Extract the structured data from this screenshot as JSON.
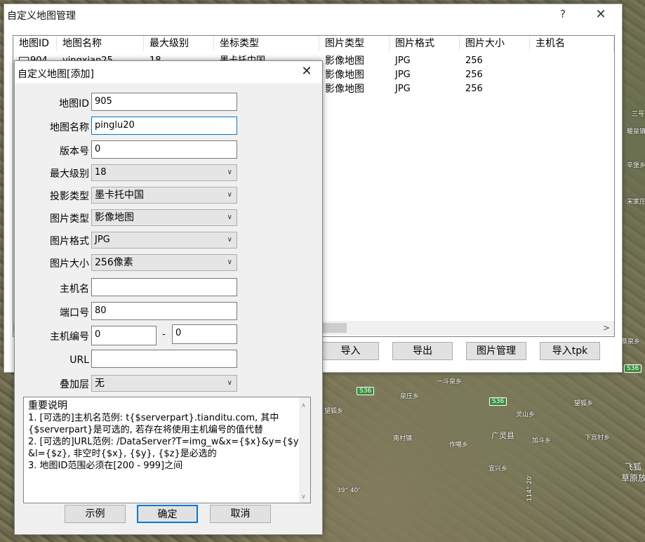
{
  "map": {
    "labels": [
      "三号",
      "辛堡乡",
      "泉庄乡",
      "一斗泉乡",
      "灵山乡",
      "南村镇",
      "作噶乡",
      "广灵县",
      "加斗乡",
      "宜兴乡",
      "下宫村乡",
      "望狐乡",
      "望狐乡",
      "飞狐",
      "草原放",
      "39° 40'",
      "114° 20'",
      "蔡泉乡",
      "宋家庄",
      "暖泉镇"
    ],
    "roads": [
      "S36",
      "S36",
      "S36"
    ]
  },
  "main_window": {
    "title": "自定义地图管理",
    "help": "?",
    "close": "✕",
    "columns": [
      "地图ID",
      "地图名称",
      "最大级别",
      "坐标类型",
      "图片类型",
      "图片格式",
      "图片大小",
      "主机名"
    ],
    "rows": [
      {
        "id": "904",
        "name": "yingxian25",
        "level": "18",
        "coord": "墨卡托中国",
        "type": "影像地图",
        "format": "JPG",
        "size": "256",
        "host": ""
      },
      {
        "id": "",
        "name": "",
        "level": "",
        "coord": "",
        "type": "影像地图",
        "format": "JPG",
        "size": "256",
        "host": ""
      },
      {
        "id": "",
        "name": "",
        "level": "",
        "coord": "",
        "type": "影像地图",
        "format": "JPG",
        "size": "256",
        "host": ""
      }
    ],
    "scroll_right": ">",
    "buttons": {
      "import": "导入",
      "export": "导出",
      "image_mgmt": "图片管理",
      "import_tpk": "导入tpk"
    }
  },
  "dialog": {
    "title": "自定义地图[添加]",
    "close": "✕",
    "labels": {
      "map_id": "地图ID",
      "map_name": "地图名称",
      "version": "版本号",
      "max_level": "最大级别",
      "projection": "投影类型",
      "image_type": "图片类型",
      "image_format": "图片格式",
      "image_size": "图片大小",
      "host": "主机名",
      "port": "端口号",
      "host_no": "主机编号",
      "url": "URL",
      "overlay": "叠加层"
    },
    "values": {
      "map_id": "905",
      "map_name": "pinglu20",
      "version": "0",
      "max_level": "18",
      "projection": "墨卡托中国",
      "image_type": "影像地图",
      "image_format": "JPG",
      "image_size": "256像素",
      "host": "",
      "port": "80",
      "host_no_from": "0",
      "host_no_to": "0",
      "url": "",
      "overlay": "无"
    },
    "dash": "-",
    "notes": [
      "重要说明",
      "1. [可选的]主机名范例: t{$serverpart}.tianditu.com, 其中",
      "{$serverpart}是可选的, 若存在将使用主机编号的值代替",
      "2. [可选的]URL范例: /DataServer?T=img_w&x={$x}&y={$y}",
      "&l={$z}, 非空时{$x}, {$y}, {$z}是必选的",
      "3. 地图ID范围必须在[200 - 999]之间"
    ],
    "buttons": {
      "example": "示例",
      "ok": "确定",
      "cancel": "取消"
    }
  }
}
